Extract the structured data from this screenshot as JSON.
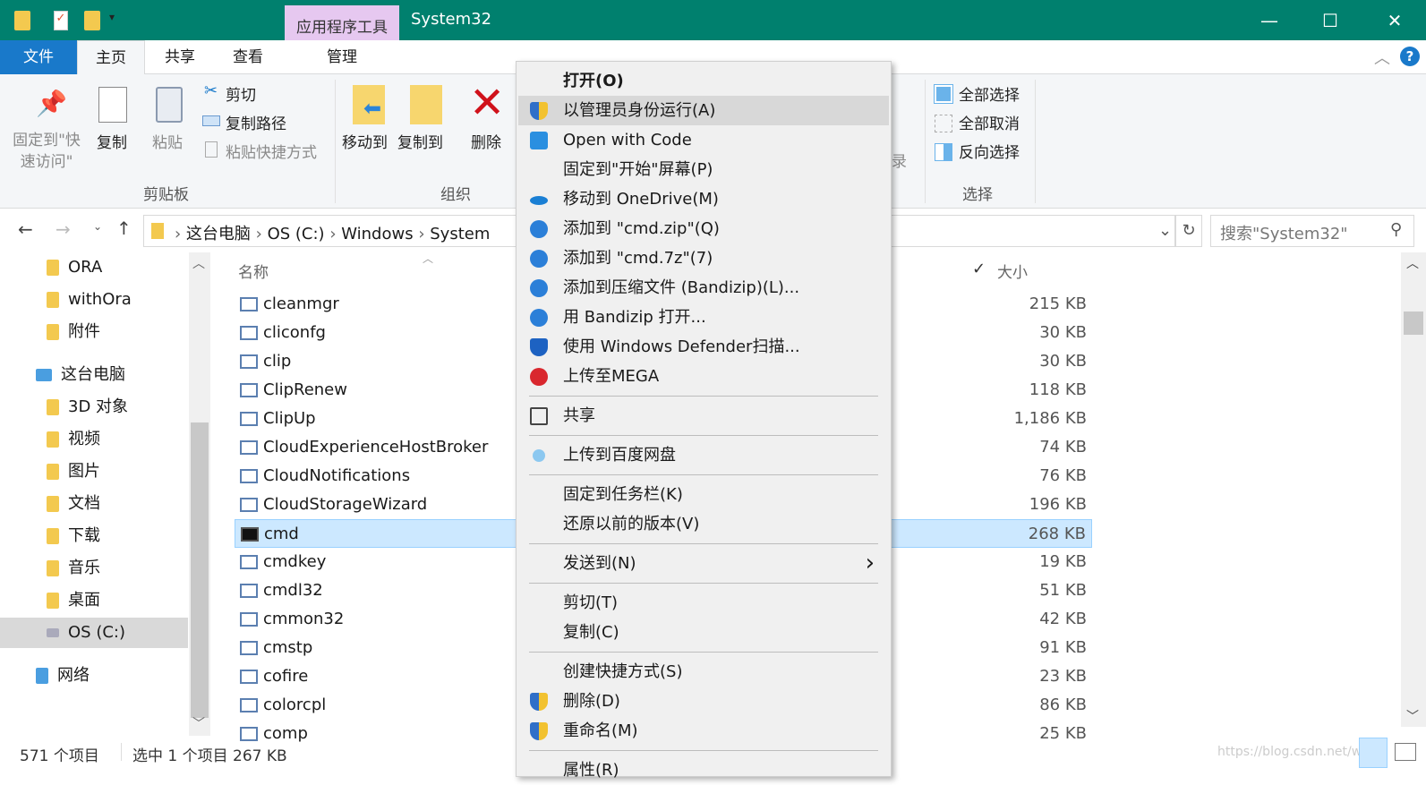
{
  "window": {
    "title": "System32",
    "contextual_tab_group": "应用程序工具",
    "minimize": "—",
    "maximize": "☐",
    "close": "✕",
    "accent": "#00806e"
  },
  "tabs": {
    "file": "文件",
    "home": "主页",
    "share": "共享",
    "view": "查看",
    "manage": "管理"
  },
  "ribbon": {
    "pin": "固定到\"快速访问\"",
    "copy": "复制",
    "paste": "粘贴",
    "cut": "剪切",
    "copy_path": "复制路径",
    "paste_shortcut": "粘贴快捷方式",
    "group_clipboard": "剪贴板",
    "move_to": "移动到",
    "copy_to": "复制到",
    "delete": "删除",
    "group_organize": "组织",
    "history_partial": "录",
    "select_all": "全部选择",
    "select_none": "全部取消",
    "invert_selection": "反向选择",
    "group_select": "选择"
  },
  "address": {
    "crumbs": [
      "这台电脑",
      "OS (C:)",
      "Windows",
      "System"
    ],
    "search_placeholder": "搜索\"System32\""
  },
  "nav": {
    "items": [
      {
        "label": "ORA"
      },
      {
        "label": "withOra"
      },
      {
        "label": "附件"
      },
      {
        "label": "这台电脑"
      },
      {
        "label": "3D 对象"
      },
      {
        "label": "视频"
      },
      {
        "label": "图片"
      },
      {
        "label": "文档"
      },
      {
        "label": "下载"
      },
      {
        "label": "音乐"
      },
      {
        "label": "桌面"
      },
      {
        "label": "OS (C:)"
      },
      {
        "label": "网络"
      }
    ]
  },
  "list": {
    "col_name": "名称",
    "col_size": "大小",
    "rows": [
      {
        "name": "cleanmgr",
        "size": "215 KB"
      },
      {
        "name": "cliconfg",
        "size": "30 KB"
      },
      {
        "name": "clip",
        "size": "30 KB"
      },
      {
        "name": "ClipRenew",
        "size": "118 KB"
      },
      {
        "name": "ClipUp",
        "size": "1,186 KB"
      },
      {
        "name": "CloudExperienceHostBroker",
        "size": "74 KB"
      },
      {
        "name": "CloudNotifications",
        "size": "76 KB"
      },
      {
        "name": "CloudStorageWizard",
        "size": "196 KB"
      },
      {
        "name": "cmd",
        "size": "268 KB",
        "selected": true
      },
      {
        "name": "cmdkey",
        "size": "19 KB"
      },
      {
        "name": "cmdl32",
        "size": "51 KB"
      },
      {
        "name": "cmmon32",
        "size": "42 KB"
      },
      {
        "name": "cmstp",
        "size": "91 KB"
      },
      {
        "name": "cofire",
        "size": "23 KB"
      },
      {
        "name": "colorcpl",
        "size": "86 KB"
      },
      {
        "name": "comp",
        "size": "25 KB"
      }
    ]
  },
  "status": {
    "count": "571 个项目",
    "selection": "选中 1 个项目  267 KB",
    "watermark": "https://blog.csdn.net/w..."
  },
  "menu": {
    "items": [
      {
        "label": "打开(O)",
        "bold": true
      },
      {
        "label": "以管理员身份运行(A)",
        "icon": "uac-shield",
        "hl": true
      },
      {
        "label": "Open with Code",
        "icon": "vscode"
      },
      {
        "label": "固定到\"开始\"屏幕(P)"
      },
      {
        "label": "移动到 OneDrive(M)",
        "icon": "onedrive"
      },
      {
        "label": "添加到 \"cmd.zip\"(Q)",
        "icon": "bandizip"
      },
      {
        "label": "添加到 \"cmd.7z\"(7)",
        "icon": "bandizip"
      },
      {
        "label": "添加到压缩文件 (Bandizip)(L)...",
        "icon": "bandizip"
      },
      {
        "label": "用 Bandizip 打开...",
        "icon": "bandizip"
      },
      {
        "label": "使用 Windows Defender扫描...",
        "icon": "defender"
      },
      {
        "label": "上传至MEGA",
        "icon": "mega",
        "sepAfter": true
      },
      {
        "label": "共享",
        "icon": "share",
        "sepAfter": true
      },
      {
        "label": "上传到百度网盘",
        "icon": "baidu",
        "sepAfter": true
      },
      {
        "label": "固定到任务栏(K)"
      },
      {
        "label": "还原以前的版本(V)",
        "sepAfter": true
      },
      {
        "label": "发送到(N)",
        "submenu": true,
        "sepAfter": true
      },
      {
        "label": "剪切(T)"
      },
      {
        "label": "复制(C)",
        "sepAfter": true
      },
      {
        "label": "创建快捷方式(S)"
      },
      {
        "label": "删除(D)",
        "icon": "uac-shield"
      },
      {
        "label": "重命名(M)",
        "icon": "uac-shield",
        "sepAfter": true
      },
      {
        "label": "属性(R)"
      }
    ]
  }
}
